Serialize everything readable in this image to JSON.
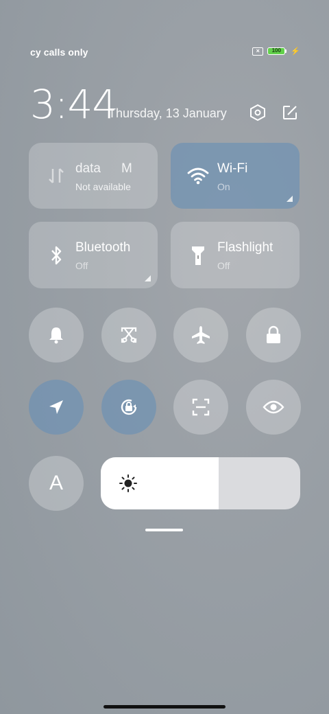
{
  "status": {
    "carrier_text": "cy calls only",
    "battery_level": "100",
    "sim_icon": "no-sim-icon",
    "charging_icon": "bolt-icon"
  },
  "header": {
    "time": "3:44",
    "date": "Thursday, 13 January",
    "settings_icon": "gear-icon",
    "edit_icon": "edit-icon"
  },
  "tiles": [
    {
      "title": "data",
      "title_extra": "M",
      "status": "Not available",
      "active": false,
      "icon": "mobile-data-icon"
    },
    {
      "title": "Wi-Fi",
      "status": "On",
      "active": true,
      "icon": "wifi-icon"
    },
    {
      "title": "Bluetooth",
      "status": "Off",
      "active": false,
      "icon": "bluetooth-icon"
    },
    {
      "title": "Flashlight",
      "status": "Off",
      "active": false,
      "icon": "flashlight-icon"
    }
  ],
  "toggles_row1": [
    {
      "name": "bell-icon",
      "active": false
    },
    {
      "name": "screenshot-icon",
      "active": false
    },
    {
      "name": "airplane-icon",
      "active": false
    },
    {
      "name": "lock-icon",
      "active": false
    }
  ],
  "toggles_row2": [
    {
      "name": "location-icon",
      "active": true
    },
    {
      "name": "rotation-lock-icon",
      "active": true
    },
    {
      "name": "scanner-icon",
      "active": false
    },
    {
      "name": "reading-mode-icon",
      "active": false
    }
  ],
  "auto_brightness": {
    "label": "A"
  },
  "brightness": {
    "level_percent": 59,
    "icon": "sun-icon"
  },
  "colors": {
    "active_tile": "#6e91b4",
    "battery_green": "#62d14b"
  }
}
